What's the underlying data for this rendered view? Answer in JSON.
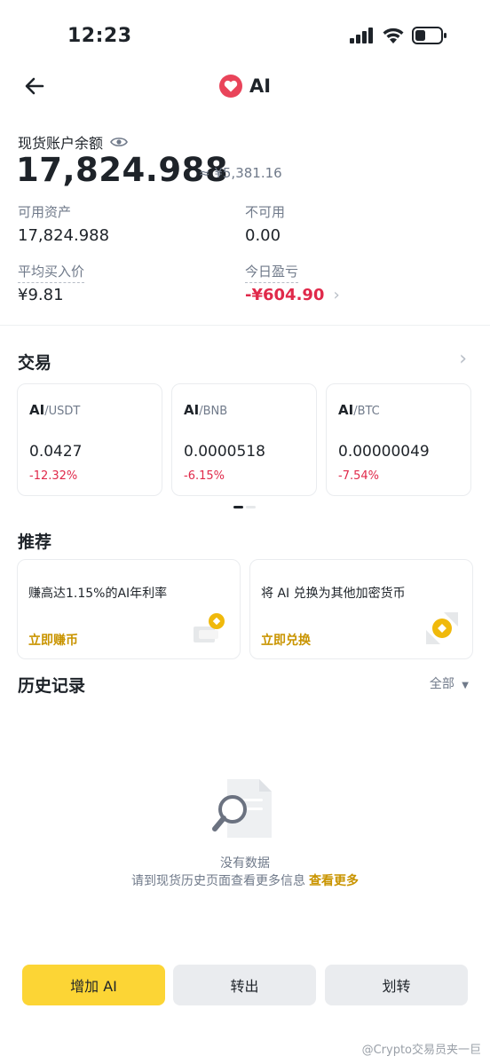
{
  "status_bar": {
    "time": "12:23"
  },
  "header": {
    "title": "AI",
    "logo_color": "#e9445a"
  },
  "balance": {
    "label": "现货账户余额",
    "amount": "17,824.988",
    "fiat": "≈ ¥5,381.16",
    "available_label": "可用资产",
    "available_value": "17,824.988",
    "unavailable_label": "不可用",
    "unavailable_value": "0.00",
    "avg_label": "平均买入价",
    "avg_value": "¥9.81",
    "pnl_label": "今日盈亏",
    "pnl_value": "-¥604.90"
  },
  "trade": {
    "title": "交易",
    "pairs": [
      {
        "base": "AI",
        "quote": "/USDT",
        "price": "0.0427",
        "change": "-12.32%"
      },
      {
        "base": "AI",
        "quote": "/BNB",
        "price": "0.0000518",
        "change": "-6.15%"
      },
      {
        "base": "AI",
        "quote": "/BTC",
        "price": "0.00000049",
        "change": "-7.54%"
      }
    ]
  },
  "recommend": {
    "title": "推荐",
    "cards": [
      {
        "text": "赚高达1.15%的AI年利率",
        "link": "立即赚币"
      },
      {
        "text": "将 AI 兑换为其他加密货币",
        "link": "立即兑换"
      }
    ]
  },
  "history": {
    "title": "历史记录",
    "filter": "全部",
    "empty_title": "没有数据",
    "empty_sub": "请到现货历史页面查看更多信息",
    "empty_link": "查看更多"
  },
  "actions": {
    "deposit": "增加 AI",
    "withdraw": "转出",
    "transfer": "划转"
  },
  "watermark": "@Crypto交易员夹一巨",
  "colors": {
    "accent": "#fcd535",
    "negative": "#e0294a",
    "link": "#c99400"
  }
}
